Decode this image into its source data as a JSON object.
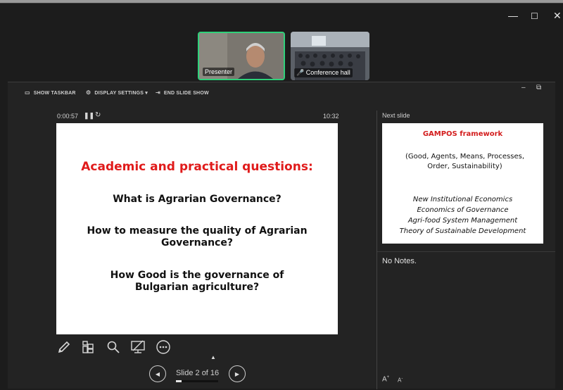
{
  "window_controls": {
    "minimize": "—",
    "maximize": "☐",
    "close": "✕"
  },
  "video_tiles": [
    {
      "label": "Presenter",
      "muted": false
    },
    {
      "label": "Conference hall",
      "muted": true,
      "mute_icon": "🎤"
    }
  ],
  "toolbar": {
    "show_taskbar": "SHOW TASKBAR",
    "display_settings": "DISPLAY SETTINGS ▾",
    "end_slide_show": "END SLIDE SHOW"
  },
  "presenter_window_controls": {
    "minimize": "–",
    "restore": "⧉"
  },
  "timer": {
    "elapsed": "0:00:57",
    "clock": "10:32"
  },
  "current_slide": {
    "title": "Academic and practical questions:",
    "questions": [
      "What is Agrarian Governance?",
      "How to measure the quality of Agrarian Governance?",
      "How Good is the governance of Bulgarian agriculture?"
    ]
  },
  "next_slide": {
    "label": "Next slide",
    "title": "GAMPOS framework",
    "acronym_line1": "(Good, Agents, Means, Processes,",
    "acronym_line2": "Order,  Sustainability)",
    "items": [
      "New Institutional Economics",
      "Economics of Governance",
      "Agri-food System Management",
      "Theory of Sustainable Development"
    ]
  },
  "notes": "No Notes.",
  "navigation": {
    "counter": "Slide 2 of 16",
    "progress": 0.125
  },
  "colors": {
    "accent_green": "#2fd07a",
    "slide_title_red": "#e01b1b"
  },
  "icons": [
    "pen-icon",
    "slide-grid-icon",
    "zoom-icon",
    "screen-toggle-icon",
    "more-options-icon",
    "pause-icon",
    "restart-icon"
  ]
}
